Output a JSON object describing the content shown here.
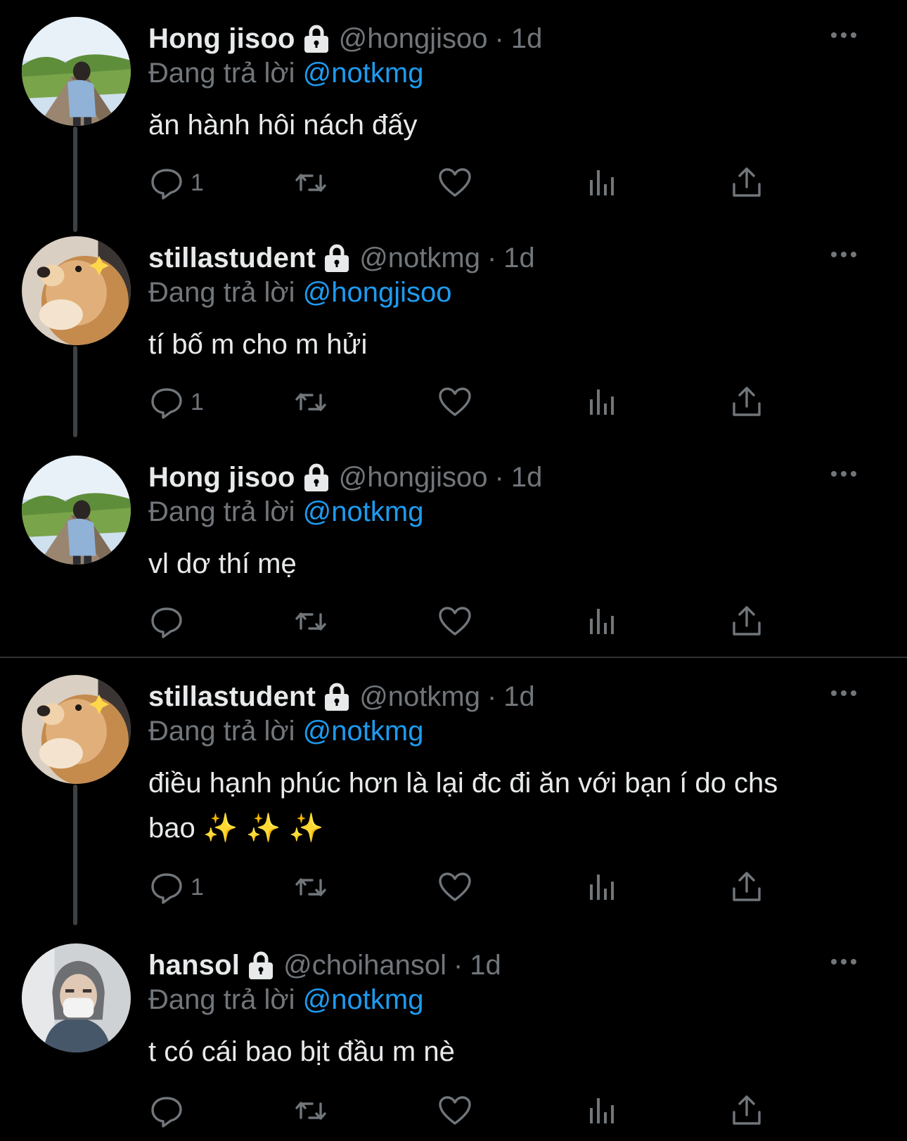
{
  "tweets": [
    {
      "name": "Hong jisoo",
      "handle": "@hongjisoo",
      "dot": "·",
      "time": "1d",
      "reply_prefix": "Đang trả lời",
      "reply_to": "@notkmg",
      "lines": [
        "ăn hành hôi nách đấy"
      ],
      "reply_count": "1",
      "avatar": "photo-man-boardwalk"
    },
    {
      "name": "stillastudent",
      "handle": "@notkmg",
      "dot": "·",
      "time": "1d",
      "reply_prefix": "Đang trả lời",
      "reply_to": "@hongjisoo",
      "lines": [
        "tí bố m cho m hửi"
      ],
      "reply_count": "1",
      "avatar": "photo-golden-retriever"
    },
    {
      "name": "Hong jisoo",
      "handle": "@hongjisoo",
      "dot": "·",
      "time": "1d",
      "reply_prefix": "Đang trả lời",
      "reply_to": "@notkmg",
      "lines": [
        "vl dơ thí mẹ"
      ],
      "reply_count": "",
      "avatar": "photo-man-boardwalk"
    },
    {
      "name": "stillastudent",
      "handle": "@notkmg",
      "dot": "·",
      "time": "1d",
      "reply_prefix": "Đang trả lời",
      "reply_to": "@notkmg",
      "lines": [
        "điều hạnh phúc hơn là lại đc đi ăn với bạn í do chs",
        "bao ✨ ✨ ✨"
      ],
      "reply_count": "1",
      "avatar": "photo-golden-retriever"
    },
    {
      "name": "hansol",
      "handle": "@choihansol",
      "dot": "·",
      "time": "1d",
      "reply_prefix": "Đang trả lời",
      "reply_to": "@notkmg",
      "lines": [
        "t có cái bao bịt đầu m nè"
      ],
      "reply_count": "",
      "avatar": "photo-masked-person"
    }
  ],
  "icons": {
    "reply": "reply-icon",
    "retweet": "retweet-icon",
    "like": "like-icon",
    "views": "views-icon",
    "share": "share-icon",
    "more": "more-icon",
    "lock": "lock-icon"
  },
  "colors": {
    "background": "#000000",
    "text": "#e7e9ea",
    "muted": "#71767b",
    "mention": "#1d9bf0",
    "thread_line": "#3e4144"
  }
}
